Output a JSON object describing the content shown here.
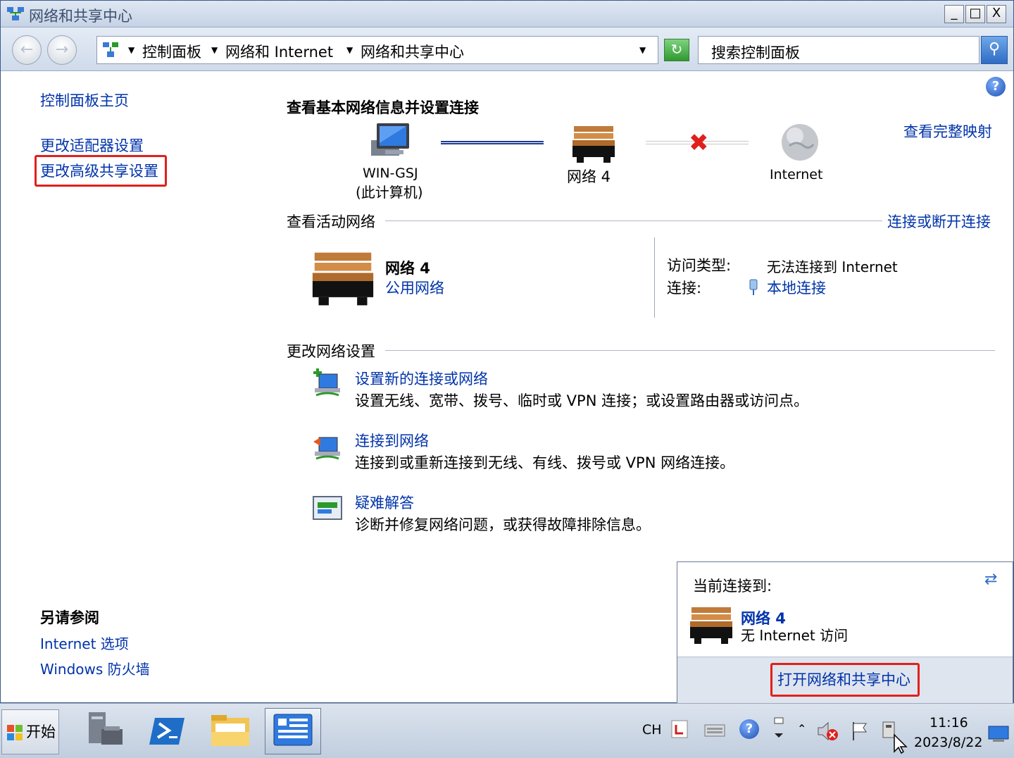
{
  "window": {
    "title": "网络和共享中心",
    "min": "_",
    "max": "□",
    "close": "X"
  },
  "address": {
    "crumbs": [
      "控制面板",
      "网络和 Internet",
      "网络和共享中心"
    ],
    "search_placeholder": "搜索控制面板"
  },
  "sidebar": {
    "home": "控制面板主页",
    "adapter": "更改适配器设置",
    "advanced": "更改高级共享设置",
    "see_also_title": "另请参阅",
    "see_also": [
      "Internet 选项",
      "Windows 防火墙"
    ]
  },
  "main": {
    "heading": "查看基本网络信息并设置连接",
    "view_full_map": "查看完整映射",
    "map": {
      "computer_line1": "WIN-GSJ",
      "computer_line2": "(此计算机)",
      "network": "网络  4",
      "internet": "Internet"
    },
    "active_section": "查看活动网络",
    "connect_disconnect": "连接或断开连接",
    "active_network": {
      "name": "网络  4",
      "category": "公用网络",
      "access_type_label": "访问类型:",
      "access_type_value": "无法连接到 Internet",
      "connection_label": "连接:",
      "connection_value": "本地连接"
    },
    "change_section": "更改网络设置",
    "tasks": [
      {
        "title": "设置新的连接或网络",
        "desc": "设置无线、宽带、拨号、临时或 VPN 连接；或设置路由器或访问点。"
      },
      {
        "title": "连接到网络",
        "desc": "连接到或重新连接到无线、有线、拨号或 VPN 网络连接。"
      },
      {
        "title": "疑难解答",
        "desc": "诊断并修复网络问题，或获得故障排除信息。"
      }
    ]
  },
  "popup": {
    "label": "当前连接到:",
    "network_name": "网络  4",
    "status": "无 Internet 访问",
    "open_center": "打开网络和共享中心"
  },
  "taskbar": {
    "start": "开始",
    "lang": "CH",
    "time": "11:16",
    "date": "2023/8/22"
  }
}
